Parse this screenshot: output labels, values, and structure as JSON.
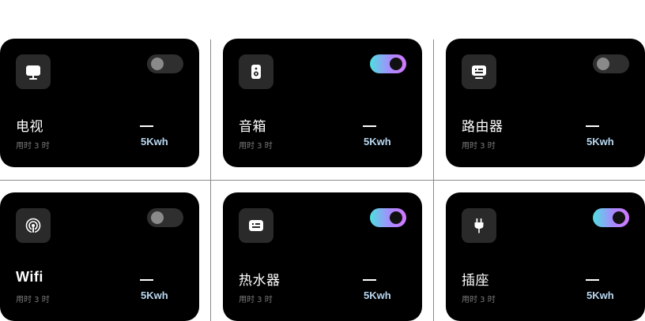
{
  "devices": [
    {
      "name": "电视",
      "usage": "用时 3 时",
      "energy": "5Kwh",
      "on": false,
      "icon": "tv-icon"
    },
    {
      "name": "音箱",
      "usage": "用时 3 时",
      "energy": "5Kwh",
      "on": true,
      "icon": "speaker-icon"
    },
    {
      "name": "路由器",
      "usage": "用时 3 时",
      "energy": "5Kwh",
      "on": false,
      "icon": "router-icon"
    },
    {
      "name": "Wifi",
      "usage": "用时 3 时",
      "energy": "5Kwh",
      "on": false,
      "icon": "wifi-icon"
    },
    {
      "name": "热水器",
      "usage": "用时 3 时",
      "energy": "5Kwh",
      "on": true,
      "icon": "water-heater-icon"
    },
    {
      "name": "插座",
      "usage": "用时 3 时",
      "energy": "5Kwh",
      "on": true,
      "icon": "plug-icon"
    }
  ],
  "colors": {
    "card_background": "#000000",
    "toggle_on_gradient": [
      "#4fe0e0",
      "#a88bff",
      "#d277ff"
    ],
    "toggle_off": "#2f2f2f",
    "energy_text": "#b9d8f2",
    "subtext": "#7c7c7c"
  }
}
